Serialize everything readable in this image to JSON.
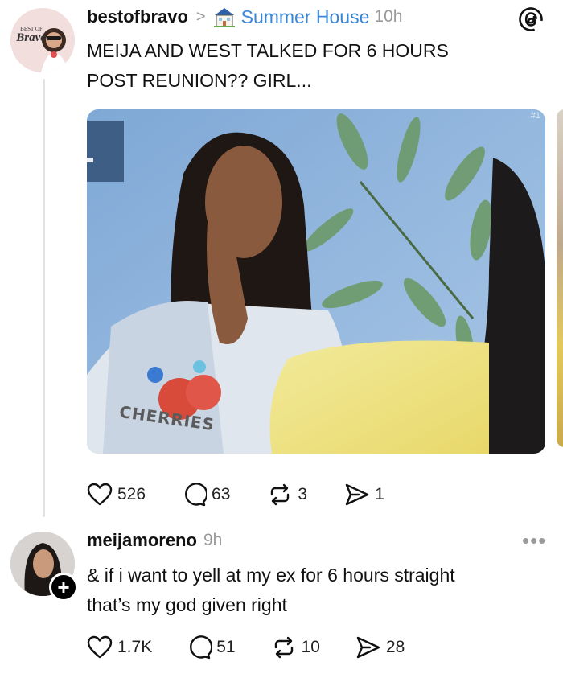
{
  "post": {
    "username": "bestofbravo",
    "separator": ">",
    "community": "Summer House",
    "time": "10h",
    "text_line1": "MEIJA AND WEST TALKED FOR 6 HOURS",
    "text_line2": "POST REUNION?? GIRL...",
    "avatar_text_top": "BEST OF",
    "avatar_text_bottom": "Bravo",
    "image_shirt_text": "CHERRIES",
    "image_corner_text": "#1",
    "actions": {
      "likes": "526",
      "replies": "63",
      "reposts": "3",
      "shares": "1"
    }
  },
  "reply": {
    "username": "meijamoreno",
    "time": "9h",
    "text_line1": "& if i want to yell at my ex for 6 hours straight",
    "text_line2": "that’s my god given right",
    "follow_symbol": "+",
    "more_symbol": "•••",
    "actions": {
      "likes": "1.7K",
      "replies": "51",
      "reposts": "10",
      "shares": "28"
    }
  },
  "icons": {
    "app_logo": "threads-logo-icon",
    "community": "house-icon",
    "like": "heart-icon",
    "reply": "comment-icon",
    "repost": "repost-icon",
    "share": "send-icon",
    "more": "more-options-icon"
  },
  "colors": {
    "text": "#111111",
    "muted": "#9a9a9a",
    "link": "#3a86d9",
    "line": "#e2e2e2"
  }
}
